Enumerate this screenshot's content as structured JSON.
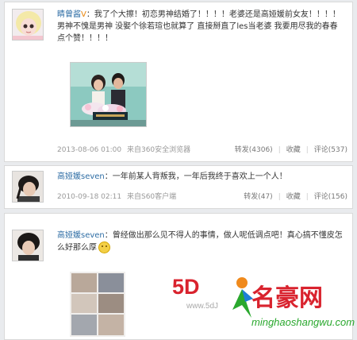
{
  "posts": [
    {
      "username": "睛曾酱",
      "badge": "V",
      "text": "：我了个大擦！初恋男神结婚了！！！！老婆还是高娅媛前女友！！！！男神不愧是男神 没娶个徐若瑄也就算了 直接掰直了les当老婆 我要用尽我的春春点个赞！！！！",
      "time": "2013-08-06 01:00",
      "source": "来自360安全浏览器",
      "repost": "转发(4306)",
      "fav": "收藏",
      "comment": "评论(537)"
    },
    {
      "username": "高娅媛seven",
      "text": "：一年前某人背叛我，一年后我终于喜欢上一个人！",
      "time": "2010-09-18 02:11",
      "source": "来自S60客户端",
      "repost": "转发(47)",
      "fav": "收藏",
      "comment": "评论(156)"
    },
    {
      "username": "高娅媛seven",
      "text": "：曾经做出那么见不得人的事情，做人呢低调点吧！真心搞不懂皮怎么好那么厚"
    }
  ],
  "watermark": {
    "brand_left": "5D",
    "site_partial": "www.5dJ",
    "brand_right": "名豪网",
    "url": "minghaoshangwu.com"
  },
  "colors": {
    "link": "#2e6da4",
    "muted": "#999999",
    "watermark_red": "#d9232e",
    "watermark_green": "#2aa82e"
  }
}
